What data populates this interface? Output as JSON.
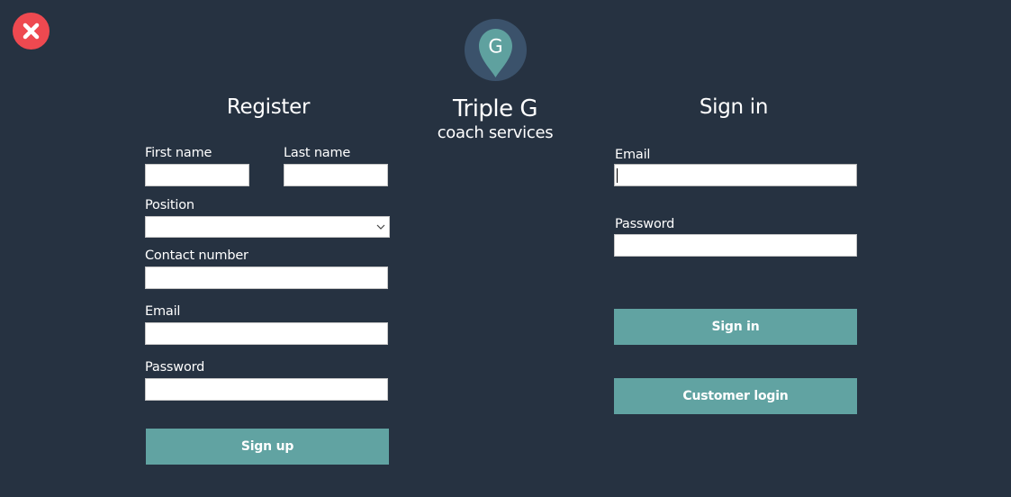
{
  "window": {
    "close_icon": "close-icon",
    "close_color": "#ee4950",
    "background": "#263241"
  },
  "brand": {
    "logo_letter": "G",
    "logo_icon": "map-pin-icon",
    "title": "Triple G",
    "subtitle": "coach services"
  },
  "register": {
    "title": "Register",
    "first_name_label": "First name",
    "first_name_value": "",
    "last_name_label": "Last name",
    "last_name_value": "",
    "position_label": "Position",
    "position_value": "",
    "contact_label": "Contact number",
    "contact_value": "",
    "email_label": "Email",
    "email_value": "",
    "password_label": "Password",
    "password_value": "",
    "signup_label": "Sign up"
  },
  "signin": {
    "title": "Sign in",
    "email_label": "Email",
    "email_value": "",
    "password_label": "Password",
    "password_value": "",
    "signin_label": "Sign in",
    "customer_login_label": "Customer login"
  },
  "colors": {
    "accent": "#61a3a2",
    "logo_circle": "#3b526b",
    "close": "#ee4950"
  }
}
